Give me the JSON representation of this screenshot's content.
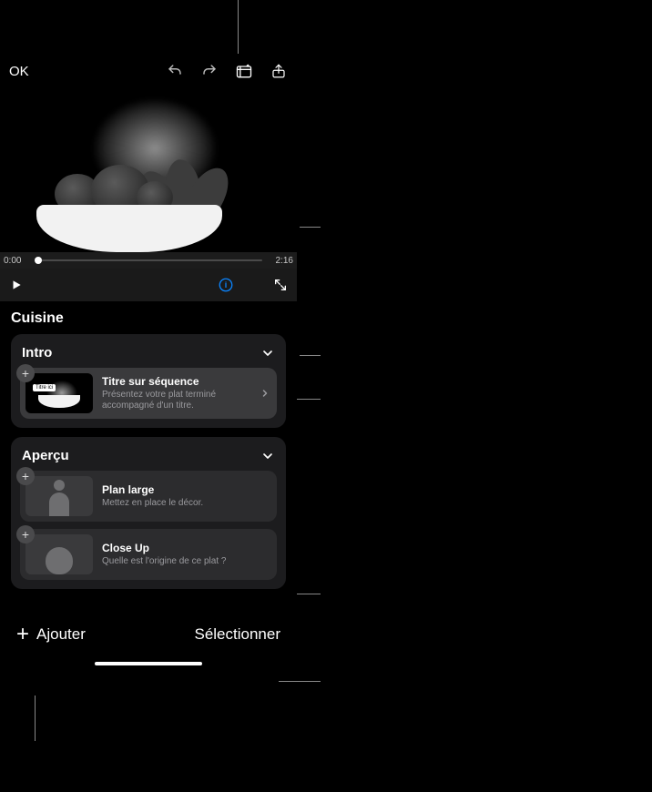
{
  "toolbar": {
    "ok_label": "OK"
  },
  "player": {
    "start_time": "0:00",
    "end_time": "2:16"
  },
  "project_title": "Cuisine",
  "sections": [
    {
      "title": "Intro",
      "shots": [
        {
          "title": "Titre sur séquence",
          "desc": "Présentez votre plat terminé accompagné d'un titre.",
          "thumb_tag": "Titre ici"
        }
      ]
    },
    {
      "title": "Aperçu",
      "shots": [
        {
          "title": "Plan large",
          "desc": "Mettez en place le décor."
        },
        {
          "title": "Close Up",
          "desc": "Quelle est l'origine de ce plat ?"
        }
      ]
    }
  ],
  "bottombar": {
    "add_label": "Ajouter",
    "select_label": "Sélectionner"
  },
  "icons": {
    "undo": "undo-icon",
    "redo": "redo-icon",
    "storyboard": "storyboard-icon",
    "share": "share-icon",
    "play": "play-icon",
    "info": "info-icon",
    "fullscreen": "fullscreen-icon",
    "chevron_down": "chevron-down-icon",
    "chevron_right": "chevron-right-icon",
    "plus": "plus-icon"
  }
}
